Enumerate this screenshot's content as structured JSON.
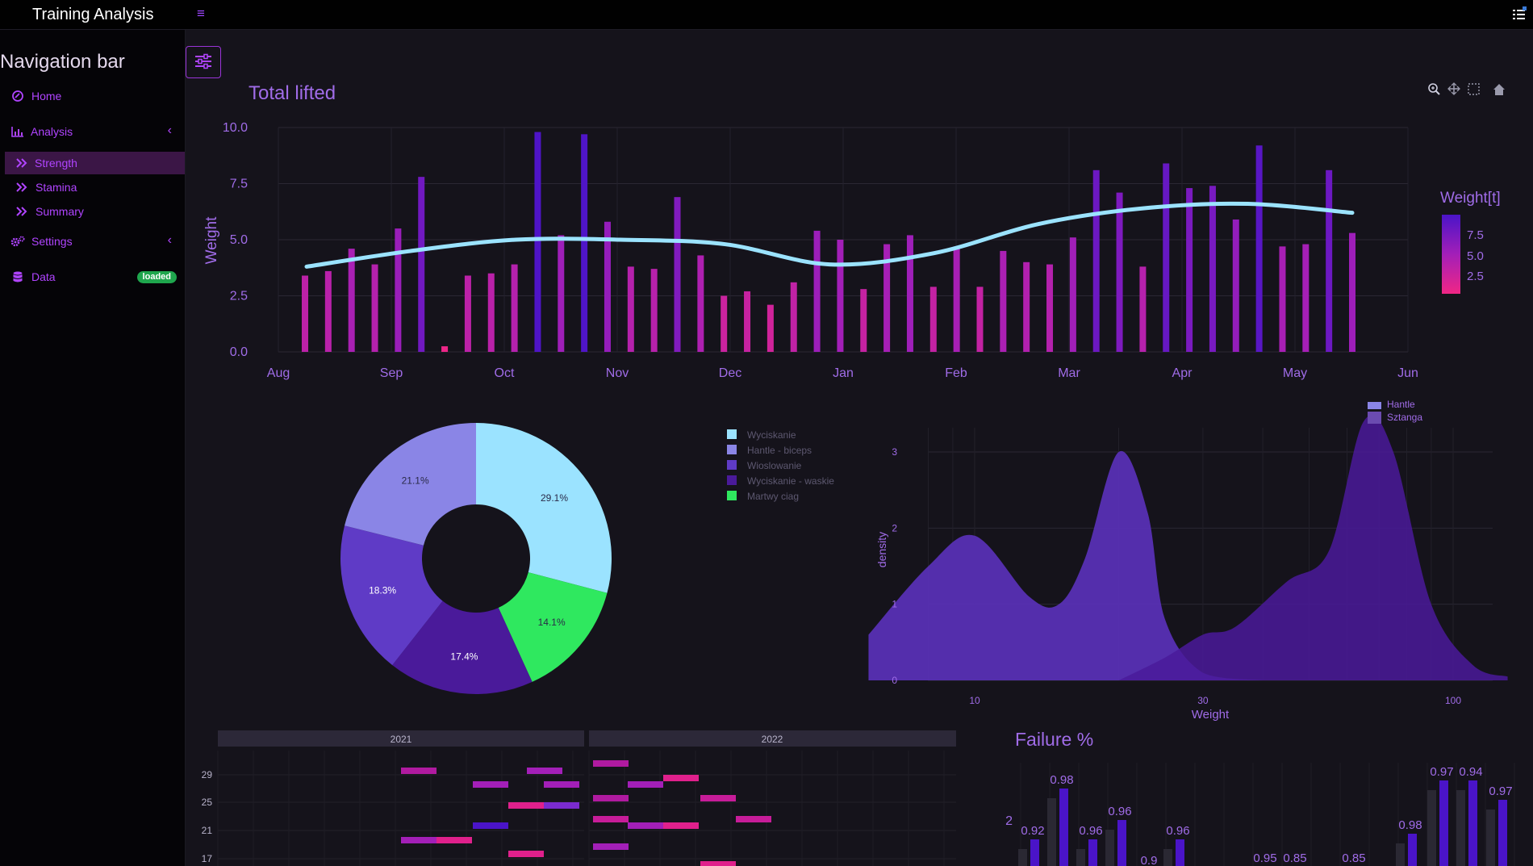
{
  "app": {
    "title": "Training Analysis"
  },
  "sidebar": {
    "title": "Navigation bar",
    "items": [
      {
        "label": "Home",
        "icon": "home-icon"
      },
      {
        "label": "Analysis",
        "icon": "chart-bar-icon",
        "expanded": true
      },
      {
        "label": "Strength",
        "icon": "double-chevron-right-icon",
        "active": true
      },
      {
        "label": "Stamina",
        "icon": "double-chevron-right-icon"
      },
      {
        "label": "Summary",
        "icon": "double-chevron-right-icon"
      },
      {
        "label": "Settings",
        "icon": "gears-icon"
      },
      {
        "label": "Data",
        "icon": "database-icon",
        "badge": "loaded"
      }
    ]
  },
  "colors": {
    "accent": "#b044ff",
    "trend_line": "#9be3ff",
    "badge": "#1fa64d"
  },
  "charts": {
    "total_lifted": {
      "title": "Total lifted"
    },
    "failure": {
      "title": "Failure %",
      "y_tick": "2"
    }
  },
  "chart_data": [
    {
      "type": "bar",
      "title": "Total lifted",
      "ylabel": "Weight",
      "ylim": [
        0,
        10
      ],
      "yticks": [
        "0.0",
        "2.5",
        "5.0",
        "7.5",
        "10.0"
      ],
      "xticks": [
        "Aug",
        "Sep",
        "Oct",
        "Nov",
        "Dec",
        "Jan",
        "Feb",
        "Mar",
        "Apr",
        "May",
        "Jun"
      ],
      "colorbar": {
        "title": "Weight[t]",
        "ticks": [
          "7.5",
          "5.0",
          "2.5"
        ]
      },
      "values": [
        3.4,
        3.6,
        4.6,
        3.9,
        5.5,
        7.8,
        0.25,
        3.4,
        3.5,
        3.9,
        9.8,
        5.2,
        9.7,
        5.8,
        3.8,
        3.7,
        6.9,
        4.3,
        2.5,
        2.7,
        2.1,
        3.1,
        5.4,
        5.0,
        2.8,
        4.8,
        5.2,
        2.9,
        4.7,
        2.9,
        4.5,
        4.0,
        3.9,
        5.1,
        8.1,
        7.1,
        3.8,
        8.4,
        7.3,
        7.4,
        5.9,
        9.2,
        4.7,
        4.8,
        8.1,
        5.3
      ],
      "trend": [
        3.8,
        4.5,
        5.0,
        5.0,
        4.8,
        3.9,
        4.4,
        5.7,
        6.4,
        6.6,
        6.2
      ]
    },
    {
      "type": "pie",
      "labels": [
        "Wyciskanie",
        "Hantle - biceps",
        "Wioslowanie",
        "Wyciskanie - waskie",
        "Martwy ciag"
      ],
      "values": [
        29.1,
        21.1,
        18.3,
        17.4,
        14.1
      ],
      "slice_labels": [
        "29.1%",
        "21.1%",
        "18.3%",
        "17.4%",
        "14.1%"
      ],
      "colors": [
        "#9be3ff",
        "#8a85e6",
        "#5f3bc6",
        "#4a1a9a",
        "#2fe85f"
      ]
    },
    {
      "type": "area",
      "xlabel": "Weight",
      "ylabel": "density",
      "xscale": "log",
      "xticks": [
        "10",
        "30",
        "100"
      ],
      "yticks": [
        "0",
        "1",
        "2",
        "3"
      ],
      "series": [
        {
          "name": "Hantle",
          "x": [
            6,
            8,
            10,
            13,
            15,
            17,
            20,
            23,
            25,
            30,
            40
          ],
          "y": [
            0.6,
            1.5,
            1.9,
            1.1,
            1.0,
            1.6,
            3.0,
            2.2,
            0.8,
            0.1,
            0
          ]
        },
        {
          "name": "Sztanga",
          "x": [
            20,
            25,
            30,
            35,
            45,
            55,
            65,
            75,
            90,
            110,
            130
          ],
          "y": [
            0,
            0.3,
            0.6,
            0.7,
            1.3,
            1.7,
            3.4,
            3.0,
            1.0,
            0.2,
            0.05
          ]
        }
      ]
    },
    {
      "type": "heatmap",
      "panels": [
        "2021",
        "2022"
      ],
      "yticks": [
        "29",
        "25",
        "21",
        "17"
      ]
    },
    {
      "type": "bar",
      "title": "Failure %",
      "data_labels": [
        "0.92",
        "0.98",
        "0.96",
        "0.96",
        "0.9",
        "0.96",
        "0.95",
        "0.85",
        "0.85",
        "0.98",
        "0.97",
        "0.94",
        "0.97"
      ]
    }
  ]
}
